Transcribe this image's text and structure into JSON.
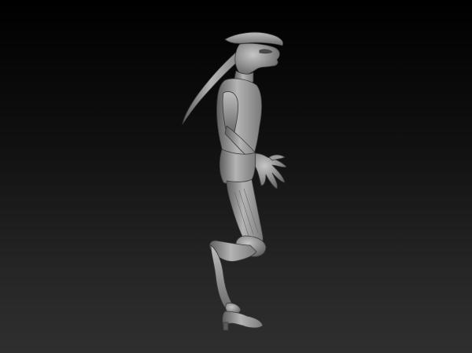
{
  "viewport": {
    "background_top": "#000000",
    "background_bottom": "#2f2f2f",
    "material_color": "#a9a9a9"
  },
  "model": {
    "subject": "alien-character-sculpt",
    "pose": "profile-walking"
  }
}
